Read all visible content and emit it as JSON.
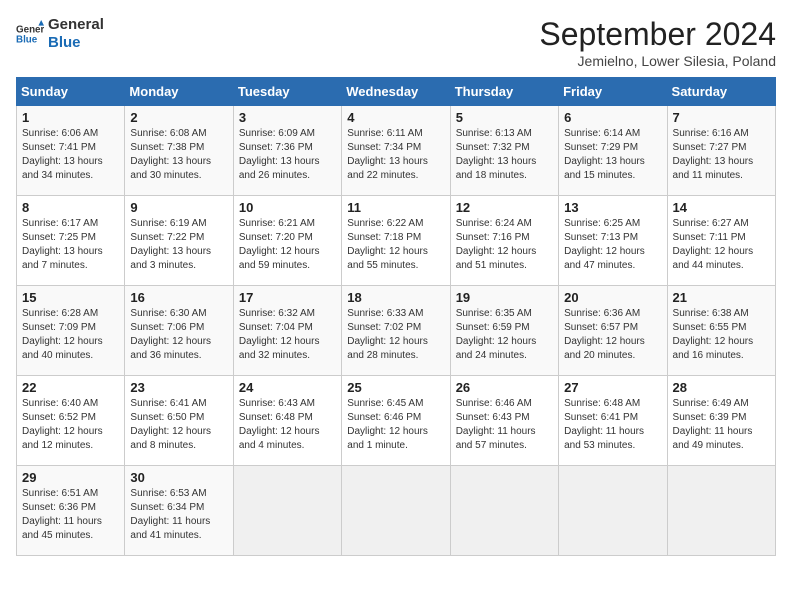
{
  "header": {
    "logo_line1": "General",
    "logo_line2": "Blue",
    "month_title": "September 2024",
    "subtitle": "Jemielno, Lower Silesia, Poland"
  },
  "weekdays": [
    "Sunday",
    "Monday",
    "Tuesday",
    "Wednesday",
    "Thursday",
    "Friday",
    "Saturday"
  ],
  "weeks": [
    [
      {
        "day": "1",
        "info": "Sunrise: 6:06 AM\nSunset: 7:41 PM\nDaylight: 13 hours\nand 34 minutes."
      },
      {
        "day": "2",
        "info": "Sunrise: 6:08 AM\nSunset: 7:38 PM\nDaylight: 13 hours\nand 30 minutes."
      },
      {
        "day": "3",
        "info": "Sunrise: 6:09 AM\nSunset: 7:36 PM\nDaylight: 13 hours\nand 26 minutes."
      },
      {
        "day": "4",
        "info": "Sunrise: 6:11 AM\nSunset: 7:34 PM\nDaylight: 13 hours\nand 22 minutes."
      },
      {
        "day": "5",
        "info": "Sunrise: 6:13 AM\nSunset: 7:32 PM\nDaylight: 13 hours\nand 18 minutes."
      },
      {
        "day": "6",
        "info": "Sunrise: 6:14 AM\nSunset: 7:29 PM\nDaylight: 13 hours\nand 15 minutes."
      },
      {
        "day": "7",
        "info": "Sunrise: 6:16 AM\nSunset: 7:27 PM\nDaylight: 13 hours\nand 11 minutes."
      }
    ],
    [
      {
        "day": "8",
        "info": "Sunrise: 6:17 AM\nSunset: 7:25 PM\nDaylight: 13 hours\nand 7 minutes."
      },
      {
        "day": "9",
        "info": "Sunrise: 6:19 AM\nSunset: 7:22 PM\nDaylight: 13 hours\nand 3 minutes."
      },
      {
        "day": "10",
        "info": "Sunrise: 6:21 AM\nSunset: 7:20 PM\nDaylight: 12 hours\nand 59 minutes."
      },
      {
        "day": "11",
        "info": "Sunrise: 6:22 AM\nSunset: 7:18 PM\nDaylight: 12 hours\nand 55 minutes."
      },
      {
        "day": "12",
        "info": "Sunrise: 6:24 AM\nSunset: 7:16 PM\nDaylight: 12 hours\nand 51 minutes."
      },
      {
        "day": "13",
        "info": "Sunrise: 6:25 AM\nSunset: 7:13 PM\nDaylight: 12 hours\nand 47 minutes."
      },
      {
        "day": "14",
        "info": "Sunrise: 6:27 AM\nSunset: 7:11 PM\nDaylight: 12 hours\nand 44 minutes."
      }
    ],
    [
      {
        "day": "15",
        "info": "Sunrise: 6:28 AM\nSunset: 7:09 PM\nDaylight: 12 hours\nand 40 minutes."
      },
      {
        "day": "16",
        "info": "Sunrise: 6:30 AM\nSunset: 7:06 PM\nDaylight: 12 hours\nand 36 minutes."
      },
      {
        "day": "17",
        "info": "Sunrise: 6:32 AM\nSunset: 7:04 PM\nDaylight: 12 hours\nand 32 minutes."
      },
      {
        "day": "18",
        "info": "Sunrise: 6:33 AM\nSunset: 7:02 PM\nDaylight: 12 hours\nand 28 minutes."
      },
      {
        "day": "19",
        "info": "Sunrise: 6:35 AM\nSunset: 6:59 PM\nDaylight: 12 hours\nand 24 minutes."
      },
      {
        "day": "20",
        "info": "Sunrise: 6:36 AM\nSunset: 6:57 PM\nDaylight: 12 hours\nand 20 minutes."
      },
      {
        "day": "21",
        "info": "Sunrise: 6:38 AM\nSunset: 6:55 PM\nDaylight: 12 hours\nand 16 minutes."
      }
    ],
    [
      {
        "day": "22",
        "info": "Sunrise: 6:40 AM\nSunset: 6:52 PM\nDaylight: 12 hours\nand 12 minutes."
      },
      {
        "day": "23",
        "info": "Sunrise: 6:41 AM\nSunset: 6:50 PM\nDaylight: 12 hours\nand 8 minutes."
      },
      {
        "day": "24",
        "info": "Sunrise: 6:43 AM\nSunset: 6:48 PM\nDaylight: 12 hours\nand 4 minutes."
      },
      {
        "day": "25",
        "info": "Sunrise: 6:45 AM\nSunset: 6:46 PM\nDaylight: 12 hours\nand 1 minute."
      },
      {
        "day": "26",
        "info": "Sunrise: 6:46 AM\nSunset: 6:43 PM\nDaylight: 11 hours\nand 57 minutes."
      },
      {
        "day": "27",
        "info": "Sunrise: 6:48 AM\nSunset: 6:41 PM\nDaylight: 11 hours\nand 53 minutes."
      },
      {
        "day": "28",
        "info": "Sunrise: 6:49 AM\nSunset: 6:39 PM\nDaylight: 11 hours\nand 49 minutes."
      }
    ],
    [
      {
        "day": "29",
        "info": "Sunrise: 6:51 AM\nSunset: 6:36 PM\nDaylight: 11 hours\nand 45 minutes."
      },
      {
        "day": "30",
        "info": "Sunrise: 6:53 AM\nSunset: 6:34 PM\nDaylight: 11 hours\nand 41 minutes."
      },
      {
        "day": "",
        "info": ""
      },
      {
        "day": "",
        "info": ""
      },
      {
        "day": "",
        "info": ""
      },
      {
        "day": "",
        "info": ""
      },
      {
        "day": "",
        "info": ""
      }
    ]
  ]
}
